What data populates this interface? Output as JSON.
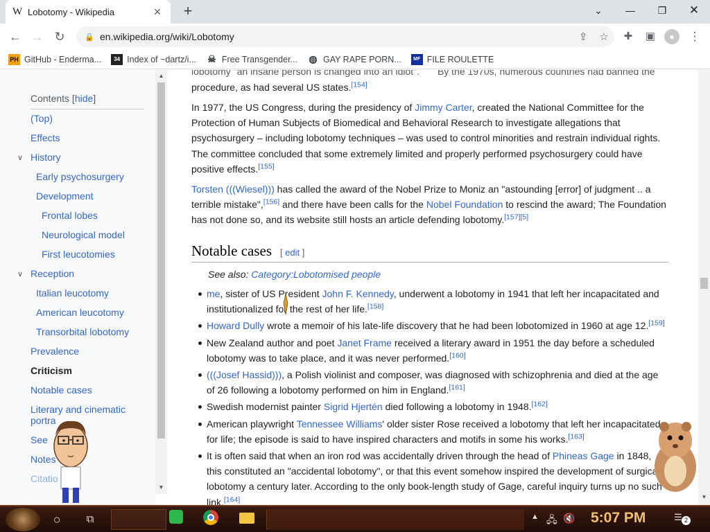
{
  "browser": {
    "tab_title": "Lobotomy - Wikipedia",
    "tab_favicon": "W",
    "url": "en.wikipedia.org/wiki/Lobotomy",
    "bookmarks": [
      {
        "label": "GitHub - Enderma...",
        "icon": "PH"
      },
      {
        "label": "Index of ~dartz/i...",
        "icon": "34"
      },
      {
        "label": "Free Transgender...",
        "icon": "skull-icon"
      },
      {
        "label": "GAY RAPE PORN...",
        "icon": "globe-icon"
      },
      {
        "label": "FILE ROULETTE",
        "icon": "MF"
      }
    ]
  },
  "toc": {
    "title": "Contents",
    "hide_label": "hide",
    "items": [
      {
        "label": "(Top)"
      },
      {
        "label": "Effects"
      },
      {
        "label": "History"
      },
      {
        "label": "Early psychosurgery"
      },
      {
        "label": "Development"
      },
      {
        "label": "Frontal lobes"
      },
      {
        "label": "Neurological model"
      },
      {
        "label": "First leucotomies"
      },
      {
        "label": "Reception"
      },
      {
        "label": "Italian leucotomy"
      },
      {
        "label": "American leucotomy"
      },
      {
        "label": "Transorbital lobotomy"
      },
      {
        "label": "Prevalence"
      },
      {
        "label": "Criticism"
      },
      {
        "label": "Notable cases"
      },
      {
        "label": "Literary and cinematic"
      },
      {
        "label": "portra"
      },
      {
        "label": "See"
      },
      {
        "label": "Notes"
      },
      {
        "label": "Citatio"
      }
    ]
  },
  "article": {
    "p0_a": "lobotomy \"an insane person is changed into an idiot\".",
    "p0_b": "By the 1970s, numerous countries had banned the",
    "p0_c": "procedure, as had several US states.",
    "p0_ref": "[154]",
    "p1_a": "In 1977, the US Congress, during the presidency of ",
    "p1_link": "Jimmy Carter",
    "p1_b": ", created the National Committee for the Protection of Human Subjects of Biomedical and Behavioral Research to investigate allegations that psychosurgery – including lobotomy techniques – was used to control minorities and restrain individual rights. The committee concluded that some extremely limited and properly performed psychosurgery could have positive effects.",
    "p1_ref": "[155]",
    "p2_link1": "Torsten (((Wiesel)))",
    "p2_a": " has called the award of the Nobel Prize to Moniz an \"astounding [error] of judgment .. a terrible mistake\",",
    "p2_ref1": "[156]",
    "p2_b": " and there have been calls for the ",
    "p2_link2": "Nobel Foundation",
    "p2_c": " to rescind the award; The Foundation has not done so, and its website still hosts an article defending lobotomy.",
    "p2_ref2": "[157][5]",
    "heading": "Notable cases",
    "edit_open": "[ ",
    "edit_label": "edit",
    "edit_close": " ]",
    "see_also_label": "See also: ",
    "see_also_link": "Category:Lobotomised people",
    "cases": [
      {
        "link": "me",
        "pre": "",
        "text": ", sister of US President ",
        "link2": "John F. Kennedy",
        "text2": ", underwent a lobotomy in 1941 that left her incapacitated and institutionalized for the rest of her life.",
        "ref": "[158]"
      },
      {
        "link": "Howard Dully",
        "pre": "",
        "text": " wrote a memoir of his late-life discovery that he had been lobotomized in 1960 at age 12.",
        "link2": "",
        "text2": "",
        "ref": "[159]"
      },
      {
        "link": "Janet Frame",
        "pre": "New Zealand author and poet ",
        "text": " received a literary award in 1951 the day before a scheduled lobotomy was to take place, and it was never performed.",
        "link2": "",
        "text2": "",
        "ref": "[160]"
      },
      {
        "link": "(((Josef Hassid)))",
        "pre": "",
        "text": ", a Polish violinist and composer, was diagnosed with schizophrenia and died at the age of 26 following a lobotomy performed on him in England.",
        "link2": "",
        "text2": "",
        "ref": "[161]"
      },
      {
        "link": "Sigrid Hjertén",
        "pre": "Swedish modernist painter ",
        "text": " died following a lobotomy in 1948.",
        "link2": "",
        "text2": "",
        "ref": "[162]"
      },
      {
        "link": "Tennessee Williams",
        "pre": "American playwright ",
        "text": "' older sister Rose received a lobotomy that left her incapacitated for life; the episode is said to have inspired characters and motifs in some his works.",
        "link2": "",
        "text2": "",
        "ref": "[163]"
      },
      {
        "link": "Phineas Gage",
        "pre": "It is often said that when an iron rod was accidentally driven through the head of ",
        "text": " in 1848, this constituted an \"accidental lobotomy\", or that this event somehow inspired the development of surgical lobotomy a century later. According to the only book-length study of Gage, careful inquiry turns up no such link.",
        "link2": "",
        "text2": "",
        "ref": "[164]"
      }
    ]
  },
  "taskbar": {
    "clock": "5:07 PM",
    "notification_count": "2"
  },
  "colors": {
    "link": "#3366cc",
    "text": "#202122",
    "clock": "#f0c070"
  }
}
